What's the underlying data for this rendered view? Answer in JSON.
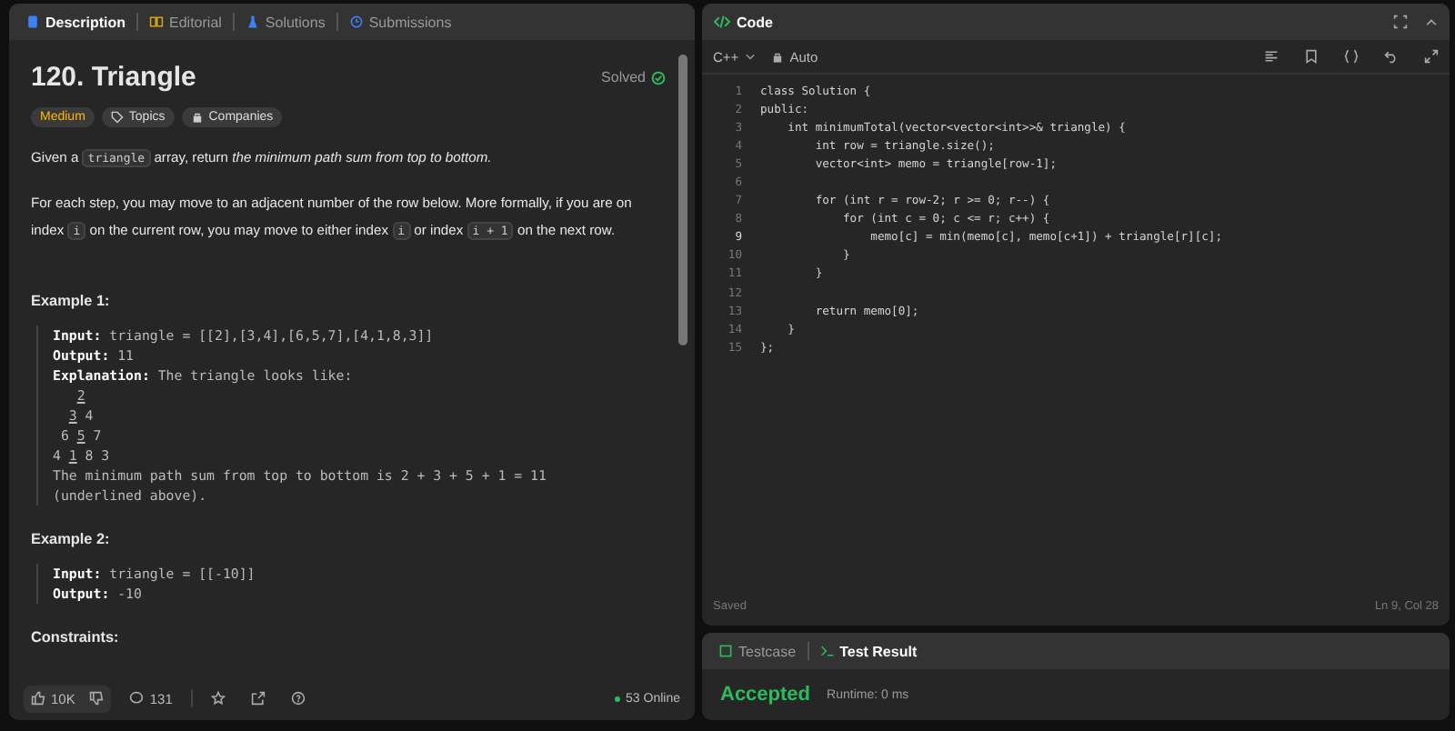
{
  "description_panel": {
    "tabs": [
      {
        "label": "Description",
        "selected": true
      },
      {
        "label": "Editorial",
        "selected": false
      },
      {
        "label": "Solutions",
        "selected": false
      },
      {
        "label": "Submissions",
        "selected": false
      }
    ],
    "title": "120. Triangle",
    "status": "Solved",
    "solved": true,
    "tags": [
      {
        "label": "Medium",
        "kind": "difficulty"
      },
      {
        "label": "Topics",
        "kind": "topics"
      },
      {
        "label": "Companies",
        "kind": "companies"
      }
    ],
    "paragraphs": [
      [
        {
          "kind": "text",
          "text": "Given a "
        },
        {
          "kind": "code",
          "text": "triangle"
        },
        {
          "kind": "text",
          "text": " array, return *the minimum path sum from top to bottom.*"
        }
      ],
      [
        {
          "kind": "text",
          "text": "For each step, you may move to an adjacent number of the row below. More formally, if you are on index "
        },
        {
          "kind": "code",
          "text": "i"
        },
        {
          "kind": "text",
          "text": " on the current row, you may move to either index "
        },
        {
          "kind": "code",
          "text": "i"
        },
        {
          "kind": "text",
          "text": " or index "
        },
        {
          "kind": "code",
          "text": "i + 1"
        },
        {
          "kind": "text",
          "text": " on the next row."
        }
      ]
    ],
    "examples": [
      {
        "heading": "Example 1:",
        "lines": [
          {
            "kind": "text",
            "text": "**Input:** triangle = [[2],[3,4],[6,5,7],[4,1,8,3]]"
          },
          {
            "kind": "text",
            "text": "**Output:** 11"
          },
          {
            "kind": "text",
            "text": "**Explanation:** The triangle looks like:"
          },
          {
            "kind": "triangle",
            "rows": [
              [
                {
                  "text": "2",
                  "underlined": true
                }
              ],
              [
                {
                  "text": "3",
                  "underlined": true
                },
                {
                  "text": "4",
                  "underlined": false
                }
              ],
              [
                {
                  "text": "6",
                  "underlined": false
                },
                {
                  "text": "5",
                  "underlined": true
                },
                {
                  "text": "7",
                  "underlined": false
                }
              ],
              [
                {
                  "text": "4",
                  "underlined": false
                },
                {
                  "text": "1",
                  "underlined": true
                },
                {
                  "text": "8",
                  "underlined": false
                },
                {
                  "text": "3",
                  "underlined": false
                }
              ]
            ]
          },
          {
            "kind": "text",
            "text": "The minimum path sum from top to bottom is 2 + 3 + 5 + 1 = 11"
          },
          {
            "kind": "text",
            "text": "(underlined above)."
          }
        ]
      },
      {
        "heading": "Example 2:",
        "lines": [
          {
            "kind": "text",
            "text": "**Input:** triangle = [[-10]]"
          },
          {
            "kind": "text",
            "text": "**Output:** -10"
          }
        ]
      }
    ],
    "constraints_heading": "Constraints:",
    "footer": {
      "likes": "10K",
      "comments": "131",
      "online": "53 Online"
    }
  },
  "code_panel": {
    "title": "Code",
    "language": "C++",
    "autocomplete": "Auto",
    "lines": [
      {
        "number": "1",
        "text": "class Solution {",
        "current": false
      },
      {
        "number": "2",
        "text": "public:",
        "current": false
      },
      {
        "number": "3",
        "text": "    int minimumTotal(vector<vector<int>>& triangle) {",
        "current": false
      },
      {
        "number": "4",
        "text": "        int row = triangle.size();",
        "current": false
      },
      {
        "number": "5",
        "text": "        vector<int> memo = triangle[row-1];",
        "current": false
      },
      {
        "number": "6",
        "current": false
      },
      {
        "number": "7",
        "text": "        for (int r = row-2; r >= 0; r--) {",
        "current": false
      },
      {
        "number": "8",
        "text": "            for (int c = 0; c <= r; c++) {",
        "current": false
      },
      {
        "number": "9",
        "text": "                memo[c] = min(memo[c], memo[c+1]) + triangle[r][c];",
        "current": true
      },
      {
        "number": "10",
        "text": "            }",
        "current": false
      },
      {
        "number": "11",
        "text": "        }",
        "current": false
      },
      {
        "number": "12",
        "current": false
      },
      {
        "number": "13",
        "text": "        return memo[0];",
        "current": false
      },
      {
        "number": "14",
        "text": "    }",
        "current": false
      },
      {
        "number": "15",
        "text": "};",
        "current": false
      }
    ],
    "save_status": "Saved",
    "cursor": "Ln 9, Col 28"
  },
  "result_panel": {
    "tabs": [
      {
        "label": "Testcase",
        "selected": false
      },
      {
        "label": "Test Result",
        "selected": true
      }
    ],
    "verdict": "Accepted",
    "runtime": "Runtime: 0 ms"
  }
}
